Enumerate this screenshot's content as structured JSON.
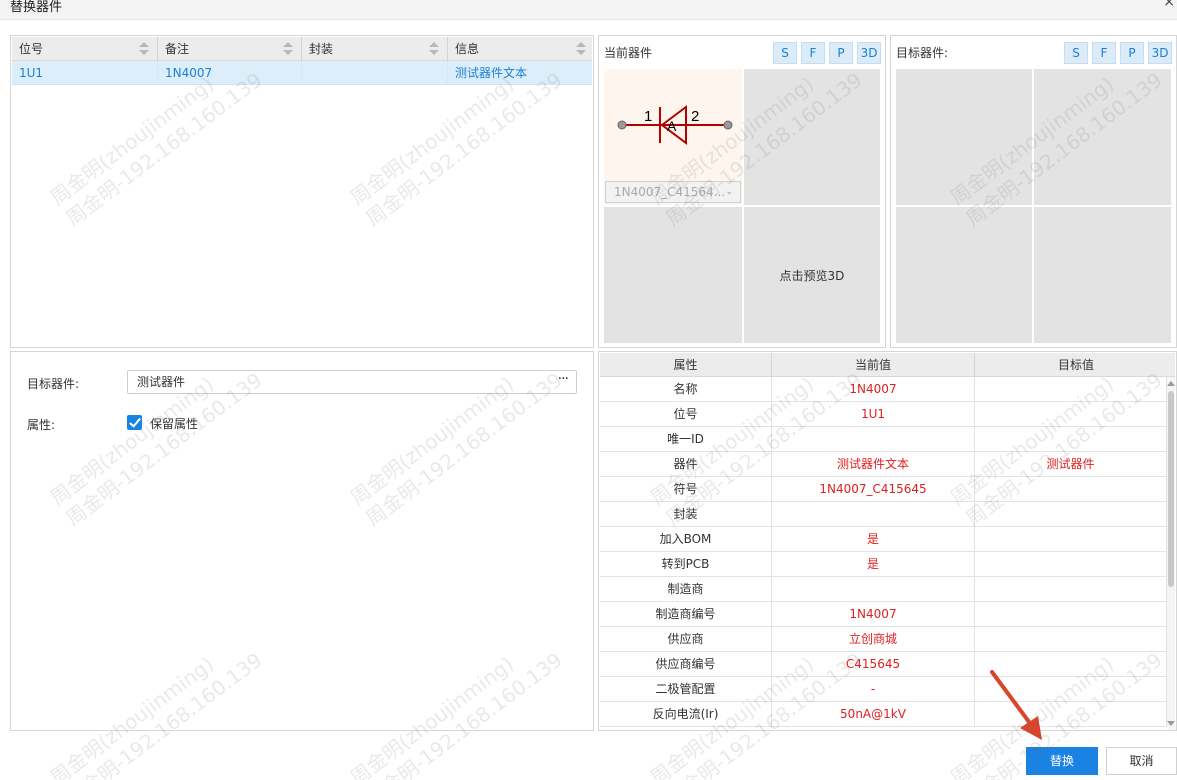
{
  "window": {
    "title": "替换器件",
    "close_glyph": "×"
  },
  "component_table": {
    "headers": [
      "位号",
      "备注",
      "封装",
      "信息"
    ],
    "row": {
      "designator": "1U1",
      "note": "1N4007",
      "footprint": "",
      "info": "测试器件文本"
    }
  },
  "current_preview": {
    "title": "当前器件",
    "buttons": [
      "S",
      "F",
      "P",
      "3D"
    ],
    "pin1": "1",
    "pin2": "2",
    "symbol_center": "A",
    "symbol_select_value": "1N4007_C41564...",
    "preview3d_label": "点击预览3D"
  },
  "target_preview": {
    "title": "目标器件:",
    "buttons": [
      "S",
      "F",
      "P",
      "3D"
    ]
  },
  "form": {
    "target_label": "目标器件:",
    "target_value": "测试器件",
    "more_glyph": "···",
    "attr_label": "属性:",
    "keep_attr_label": "保留属性",
    "keep_attr_checked": true
  },
  "attr_table": {
    "headers": [
      "属性",
      "当前值",
      "目标值"
    ],
    "rows": [
      {
        "name": "名称",
        "current": "1N4007",
        "target": ""
      },
      {
        "name": "位号",
        "current": "1U1",
        "target": ""
      },
      {
        "name": "唯一ID",
        "current": "",
        "target": ""
      },
      {
        "name": "器件",
        "current": "测试器件文本",
        "target": "测试器件"
      },
      {
        "name": "符号",
        "current": "1N4007_C415645",
        "target": ""
      },
      {
        "name": "封装",
        "current": "",
        "target": ""
      },
      {
        "name": "加入BOM",
        "current": "是",
        "target": ""
      },
      {
        "name": "转到PCB",
        "current": "是",
        "target": ""
      },
      {
        "name": "制造商",
        "current": "",
        "target": ""
      },
      {
        "name": "制造商编号",
        "current": "1N4007",
        "target": ""
      },
      {
        "name": "供应商",
        "current": "立创商城",
        "target": ""
      },
      {
        "name": "供应商编号",
        "current": "C415645",
        "target": ""
      },
      {
        "name": "二极管配置",
        "current": "-",
        "target": ""
      },
      {
        "name": "反向电流(Ir)",
        "current": "50nA@1kV",
        "target": ""
      }
    ]
  },
  "footer": {
    "replace_label": "替换",
    "cancel_label": "取消"
  },
  "watermark": {
    "line1": "周金明(zhoujinming)",
    "line2": "周金明-192.168.160.139"
  },
  "colors": {
    "accent": "#1a82e2",
    "value_red": "#e02020",
    "selected_row": "#ddeefb",
    "annotation_arrow": "#d9452b"
  }
}
